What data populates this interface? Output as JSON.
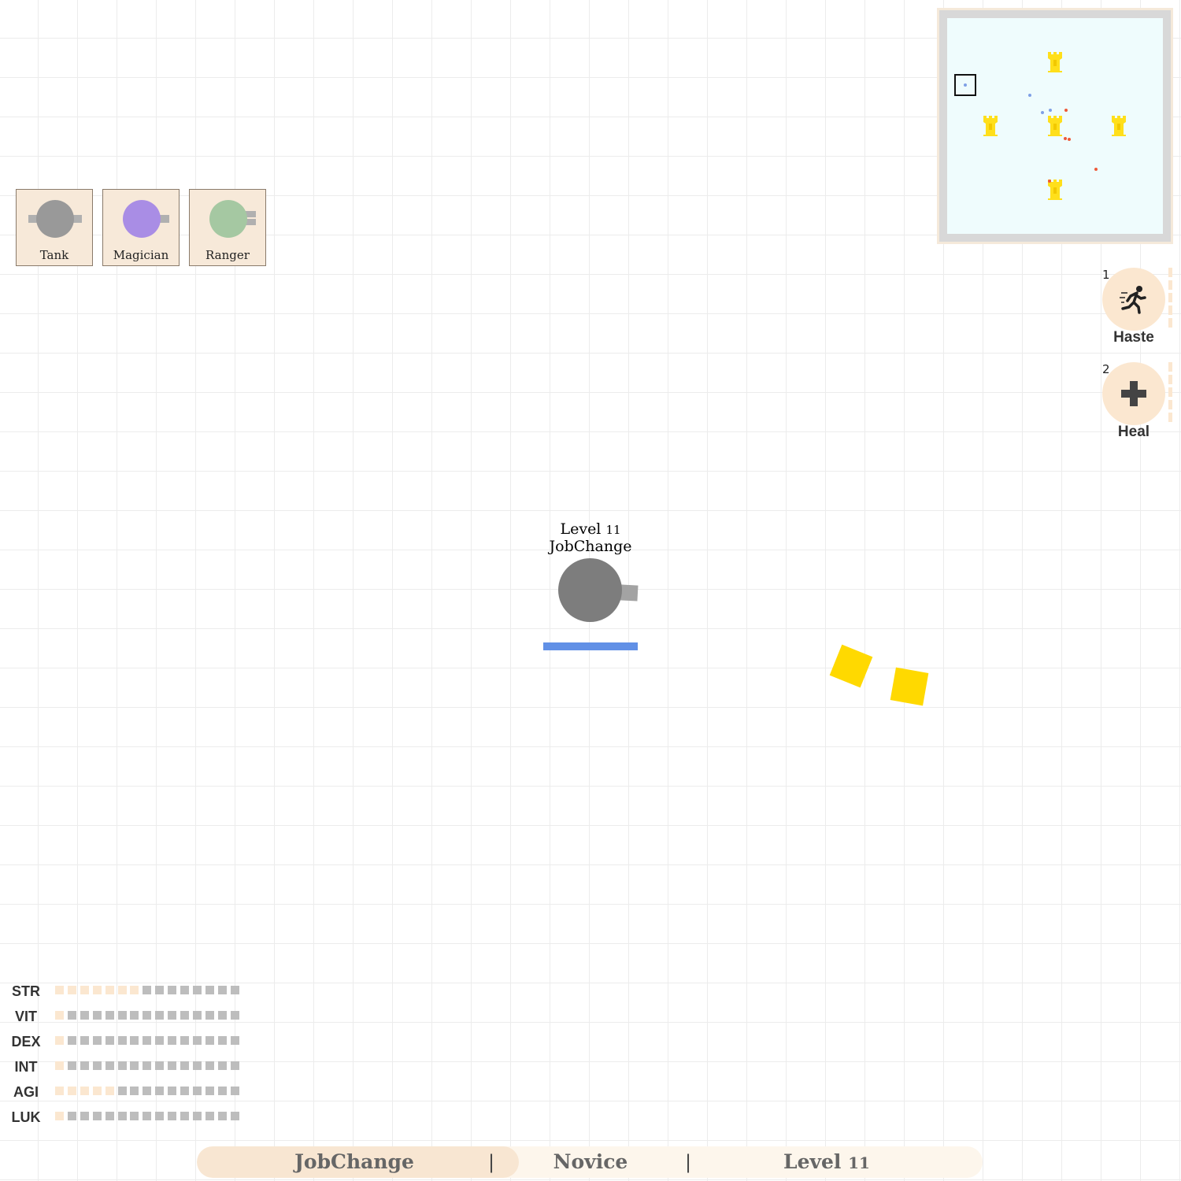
{
  "jobs": [
    {
      "label": "Tank",
      "color": "#999999"
    },
    {
      "label": "Magician",
      "color": "#a98de5"
    },
    {
      "label": "Ranger",
      "color": "#a5c8a2"
    }
  ],
  "minimap": {
    "field_color": "#effcfd",
    "tower_color": "#ffdf1b",
    "ally_color": "#7fa0e6",
    "enemy_color": "#ee5a3a"
  },
  "skills": [
    {
      "key": "1",
      "label": "Haste",
      "icon": "running-man-icon"
    },
    {
      "key": "2",
      "label": "Heal",
      "icon": "plus-cross-icon"
    }
  ],
  "player": {
    "level_word": "Level",
    "level_num": "11",
    "name": "JobChange",
    "hp_fraction": 1.0,
    "body_color": "#7d7d7d",
    "hp_color": "#6190e6"
  },
  "shapes": {
    "color": "#ffd900",
    "count": 2
  },
  "stats": [
    {
      "name": "STR",
      "points": 7,
      "max": 15
    },
    {
      "name": "VIT",
      "points": 1,
      "max": 15
    },
    {
      "name": "DEX",
      "points": 1,
      "max": 15
    },
    {
      "name": "INT",
      "points": 1,
      "max": 15
    },
    {
      "name": "AGI",
      "points": 5,
      "max": 15
    },
    {
      "name": "LUK",
      "points": 1,
      "max": 15
    }
  ],
  "bottom_bar": {
    "name": "JobChange",
    "separator": "|",
    "job": "Novice",
    "level_word": "Level",
    "level_num": "11",
    "progress": 0.41
  }
}
